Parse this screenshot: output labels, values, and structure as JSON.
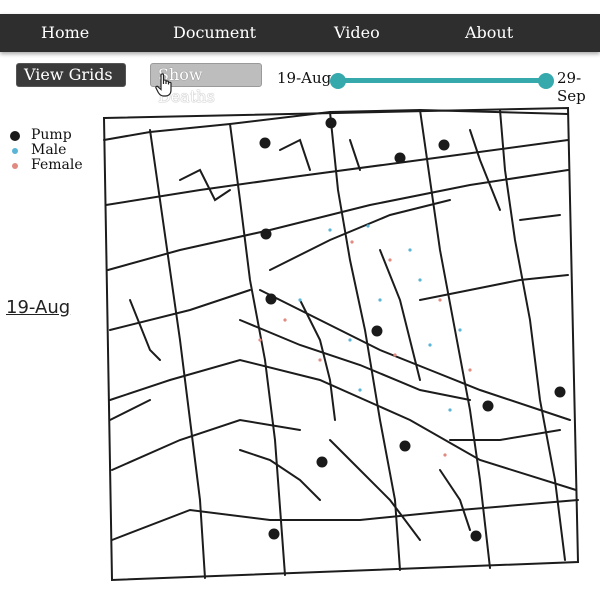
{
  "nav": {
    "items": [
      "Home",
      "Document",
      "Video",
      "About"
    ]
  },
  "buttons": {
    "view_grids": "View Grids",
    "show_deaths": "Show Deaths"
  },
  "timeline": {
    "start_label": "19-Aug",
    "end_label": "29-Sep",
    "range_start": 0,
    "range_end": 1
  },
  "current_date": "19-Aug",
  "legend": [
    {
      "label": "Pump",
      "color": "#1a1a1a"
    },
    {
      "label": "Male",
      "color": "#5ab4d6"
    },
    {
      "label": "Female",
      "color": "#e08a80"
    }
  ]
}
